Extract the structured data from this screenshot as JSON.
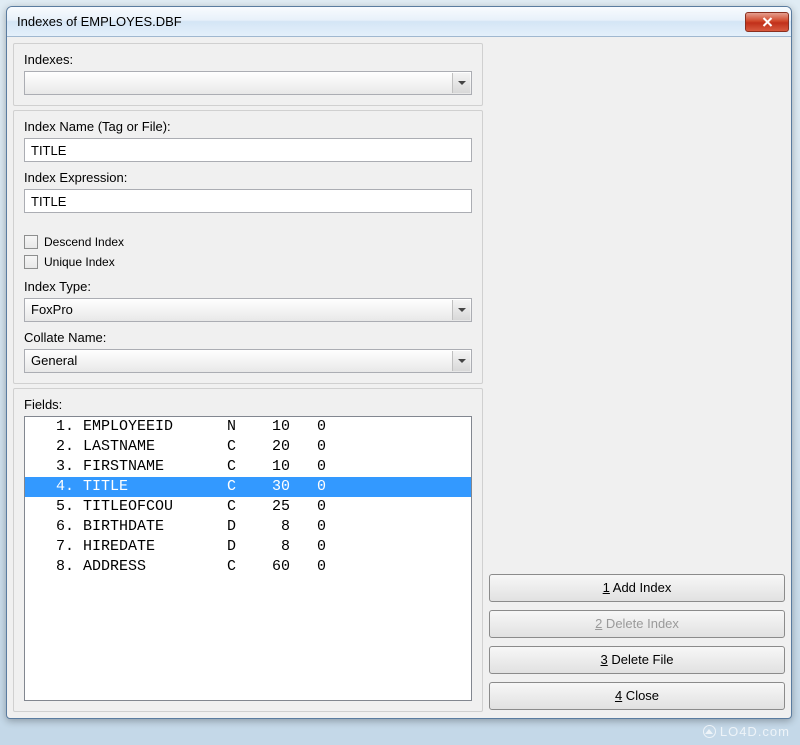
{
  "window": {
    "title": "Indexes of EMPLOYES.DBF"
  },
  "indexes_section": {
    "label": "Indexes:",
    "selected": ""
  },
  "index_name": {
    "label": "Index Name (Tag or File):",
    "value": "TITLE"
  },
  "index_expr": {
    "label": "Index Expression:",
    "value": "TITLE"
  },
  "descend": {
    "label": "Descend Index",
    "checked": false
  },
  "unique": {
    "label": "Unique Index",
    "checked": false
  },
  "index_type": {
    "label": "Index Type:",
    "value": "FoxPro"
  },
  "collate": {
    "label": "Collate Name:",
    "value": "General"
  },
  "fields_section": {
    "label": "Fields:",
    "selected_index": 3,
    "rows": [
      {
        "num": "1.",
        "name": "EMPLOYEEID",
        "type": "N",
        "len": "10",
        "dec": "0"
      },
      {
        "num": "2.",
        "name": "LASTNAME",
        "type": "C",
        "len": "20",
        "dec": "0"
      },
      {
        "num": "3.",
        "name": "FIRSTNAME",
        "type": "C",
        "len": "10",
        "dec": "0"
      },
      {
        "num": "4.",
        "name": "TITLE",
        "type": "C",
        "len": "30",
        "dec": "0"
      },
      {
        "num": "5.",
        "name": "TITLEOFCOU",
        "type": "C",
        "len": "25",
        "dec": "0"
      },
      {
        "num": "6.",
        "name": "BIRTHDATE",
        "type": "D",
        "len": "8",
        "dec": "0"
      },
      {
        "num": "7.",
        "name": "HIREDATE",
        "type": "D",
        "len": "8",
        "dec": "0"
      },
      {
        "num": "8.",
        "name": "ADDRESS",
        "type": "C",
        "len": "60",
        "dec": "0"
      }
    ]
  },
  "buttons": {
    "add": {
      "accel": "1",
      "label": " Add Index"
    },
    "del": {
      "accel": "2",
      "label": " Delete Index"
    },
    "delf": {
      "accel": "3",
      "label": " Delete File"
    },
    "close": {
      "accel": "4",
      "label": " Close"
    }
  },
  "watermark": "LO4D.com"
}
